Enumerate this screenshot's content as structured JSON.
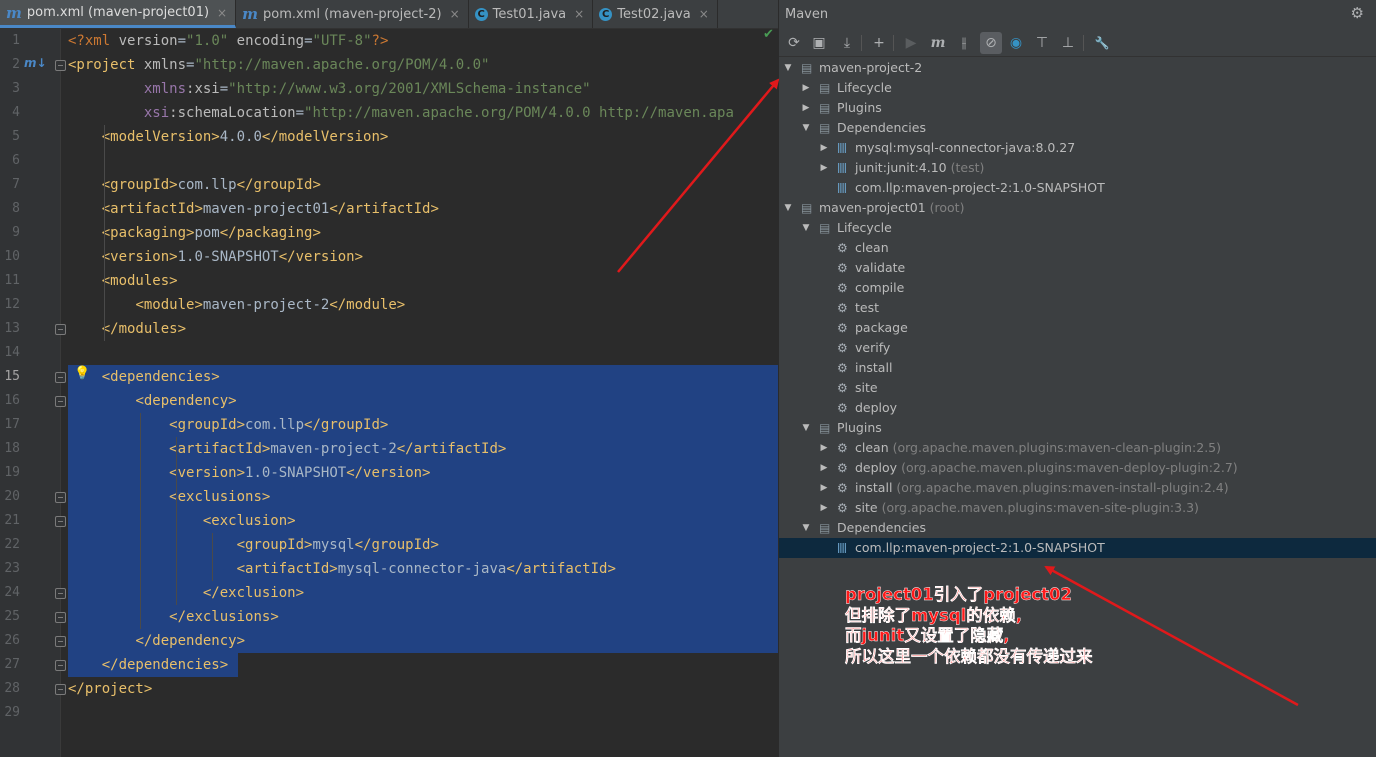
{
  "tabs": [
    {
      "label": "pom.xml (maven-project01)",
      "icon": "maven-m-icon",
      "active": true,
      "close": "×"
    },
    {
      "label": "pom.xml (maven-project-2)",
      "icon": "maven-m-icon",
      "active": false,
      "close": "×"
    },
    {
      "label": "Test01.java",
      "icon": "class-c-icon",
      "active": false,
      "close": "×"
    },
    {
      "label": "Test02.java",
      "icon": "class-c-icon",
      "active": false,
      "close": "×"
    }
  ],
  "editor": {
    "line_numbers": [
      "1",
      "2",
      "3",
      "4",
      "5",
      "6",
      "7",
      "8",
      "9",
      "10",
      "11",
      "12",
      "13",
      "14",
      "15",
      "16",
      "17",
      "18",
      "19",
      "20",
      "21",
      "22",
      "23",
      "24",
      "25",
      "26",
      "27",
      "28",
      "29"
    ],
    "current_line": "15",
    "selection": {
      "from_line": "15",
      "to_line": "27"
    },
    "code_lines": [
      "<?xml version=\"1.0\" encoding=\"UTF-8\"?>",
      "<project xmlns=\"http://maven.apache.org/POM/4.0.0\"",
      "         xmlns:xsi=\"http://www.w3.org/2001/XMLSchema-instance\"",
      "         xsi:schemaLocation=\"http://maven.apache.org/POM/4.0.0 http://maven.apa",
      "    <modelVersion>4.0.0</modelVersion>",
      "",
      "    <groupId>com.llp</groupId>",
      "    <artifactId>maven-project01</artifactId>",
      "    <packaging>pom</packaging>",
      "    <version>1.0-SNAPSHOT</version>",
      "    <modules>",
      "        <module>maven-project-2</module>",
      "    </modules>",
      "",
      "    <dependencies>",
      "        <dependency>",
      "            <groupId>com.llp</groupId>",
      "            <artifactId>maven-project-2</artifactId>",
      "            <version>1.0-SNAPSHOT</version>",
      "            <exclusions>",
      "                <exclusion>",
      "                    <groupId>mysql</groupId>",
      "                    <artifactId>mysql-connector-java</artifactId>",
      "                </exclusion>",
      "            </exclusions>",
      "        </dependency>",
      "    </dependencies>",
      "</project>",
      ""
    ]
  },
  "maven_panel": {
    "title": "Maven",
    "settings_icon": "gear-icon",
    "toolbar_icons": [
      "reload-all-icon",
      "reimport-folder-icon",
      "download-sources-icon",
      "add-project-icon",
      "run-icon",
      "execute-goal-icon",
      "toggle-offline-icon",
      "skip-tests-icon",
      "show-dependencies-icon",
      "expand-all-icon",
      "collapse-all-icon",
      "settings-wrench-icon"
    ],
    "tree": [
      {
        "level": 0,
        "arrow": "down",
        "icon": "module",
        "label": "maven-project-2",
        "suffix": ""
      },
      {
        "level": 1,
        "arrow": "right",
        "icon": "folder",
        "label": "Lifecycle",
        "suffix": ""
      },
      {
        "level": 1,
        "arrow": "right",
        "icon": "folder",
        "label": "Plugins",
        "suffix": ""
      },
      {
        "level": 1,
        "arrow": "down",
        "icon": "folder",
        "label": "Dependencies",
        "suffix": ""
      },
      {
        "level": 2,
        "arrow": "right",
        "icon": "lib",
        "label": "mysql:mysql-connector-java:8.0.27",
        "suffix": ""
      },
      {
        "level": 2,
        "arrow": "right",
        "icon": "lib",
        "label": "junit:junit:4.10",
        "suffix": "(test)"
      },
      {
        "level": 2,
        "arrow": "",
        "icon": "lib",
        "label": "com.llp:maven-project-2:1.0-SNAPSHOT",
        "suffix": ""
      },
      {
        "level": 0,
        "arrow": "down",
        "icon": "module",
        "label": "maven-project01",
        "suffix": "(root)"
      },
      {
        "level": 1,
        "arrow": "down",
        "icon": "folder",
        "label": "Lifecycle",
        "suffix": ""
      },
      {
        "level": 2,
        "arrow": "",
        "icon": "gear",
        "label": "clean",
        "suffix": ""
      },
      {
        "level": 2,
        "arrow": "",
        "icon": "gear",
        "label": "validate",
        "suffix": ""
      },
      {
        "level": 2,
        "arrow": "",
        "icon": "gear",
        "label": "compile",
        "suffix": ""
      },
      {
        "level": 2,
        "arrow": "",
        "icon": "gear",
        "label": "test",
        "suffix": ""
      },
      {
        "level": 2,
        "arrow": "",
        "icon": "gear",
        "label": "package",
        "suffix": ""
      },
      {
        "level": 2,
        "arrow": "",
        "icon": "gear",
        "label": "verify",
        "suffix": ""
      },
      {
        "level": 2,
        "arrow": "",
        "icon": "gear",
        "label": "install",
        "suffix": ""
      },
      {
        "level": 2,
        "arrow": "",
        "icon": "gear",
        "label": "site",
        "suffix": ""
      },
      {
        "level": 2,
        "arrow": "",
        "icon": "gear",
        "label": "deploy",
        "suffix": ""
      },
      {
        "level": 1,
        "arrow": "down",
        "icon": "folder",
        "label": "Plugins",
        "suffix": ""
      },
      {
        "level": 2,
        "arrow": "right",
        "icon": "plugin",
        "label": "clean",
        "suffix": "(org.apache.maven.plugins:maven-clean-plugin:2.5)"
      },
      {
        "level": 2,
        "arrow": "right",
        "icon": "plugin",
        "label": "deploy",
        "suffix": "(org.apache.maven.plugins:maven-deploy-plugin:2.7)"
      },
      {
        "level": 2,
        "arrow": "right",
        "icon": "plugin",
        "label": "install",
        "suffix": "(org.apache.maven.plugins:maven-install-plugin:2.4)"
      },
      {
        "level": 2,
        "arrow": "right",
        "icon": "plugin",
        "label": "site",
        "suffix": "(org.apache.maven.plugins:maven-site-plugin:3.3)"
      },
      {
        "level": 1,
        "arrow": "down",
        "icon": "folder",
        "label": "Dependencies",
        "suffix": ""
      },
      {
        "level": 2,
        "arrow": "",
        "icon": "lib",
        "label": "com.llp:maven-project-2:1.0-SNAPSHOT",
        "suffix": "",
        "selected": true
      }
    ]
  },
  "annotation": {
    "lines": [
      "project01引入了project02",
      "但排除了mysql的依赖,",
      "而junit又设置了隐藏,",
      "所以这里一个依赖都没有传递过来"
    ],
    "color": "#ff1a1a"
  }
}
